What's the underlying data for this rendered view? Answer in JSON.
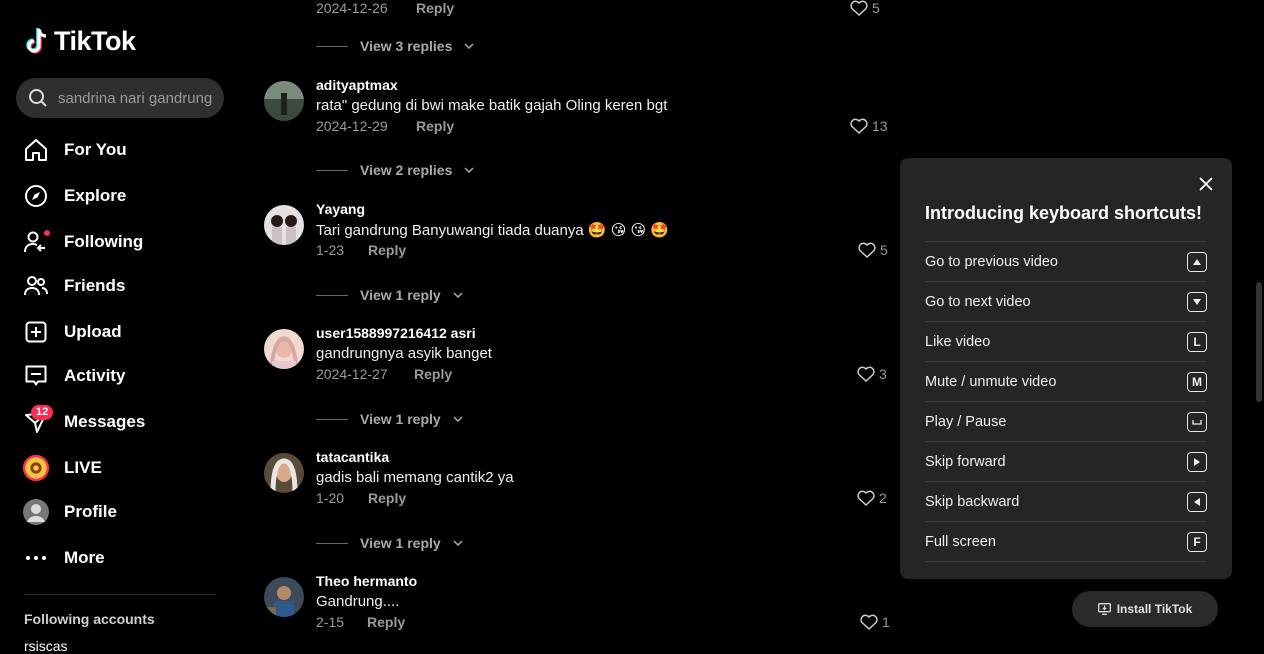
{
  "app": {
    "logo_text": "TikTok"
  },
  "search": {
    "placeholder": "sandrina nari gandrung"
  },
  "nav": {
    "for_you": "For You",
    "explore": "Explore",
    "following": "Following",
    "friends": "Friends",
    "upload": "Upload",
    "activity": "Activity",
    "messages": "Messages",
    "messages_badge": "12",
    "live": "LIVE",
    "profile": "Profile",
    "more": "More"
  },
  "sidebar": {
    "following_accounts_label": "Following accounts",
    "partial_account": "rsiscas"
  },
  "comments": {
    "top": {
      "date": "2024-12-26",
      "reply": "Reply",
      "likes": "5",
      "view_replies": "View 3 replies"
    },
    "items": [
      {
        "user": "adityaptmax",
        "text": "rata\" gedung di bwi make batik gajah Oling keren bgt",
        "date": "2024-12-29",
        "reply": "Reply",
        "likes": "13",
        "view_replies": "View 2 replies"
      },
      {
        "user": "Yayang",
        "text": "Tari gandrung Banyuwangi tiada duanya 🤩 😘 😘 🤩",
        "date": "1-23",
        "reply": "Reply",
        "likes": "5",
        "view_replies": "View 1 reply"
      },
      {
        "user": "user1588997216412 asri",
        "text": "gandrungnya asyik banget",
        "date": "2024-12-27",
        "reply": "Reply",
        "likes": "3",
        "view_replies": "View 1 reply"
      },
      {
        "user": "tatacantika",
        "text": "gadis bali memang cantik2 ya",
        "date": "1-20",
        "reply": "Reply",
        "likes": "2",
        "view_replies": "View 1 reply"
      },
      {
        "user": "Theo hermanto",
        "text": "Gandrung....",
        "date": "2-15",
        "reply": "Reply",
        "likes": "1"
      }
    ]
  },
  "shortcuts": {
    "title": "Introducing keyboard shortcuts!",
    "items": [
      {
        "label": "Go to previous video",
        "key": "up-arrow-key"
      },
      {
        "label": "Go to next video",
        "key": "down-arrow-key"
      },
      {
        "label": "Like video",
        "key_text": "L"
      },
      {
        "label": "Mute / unmute video",
        "key_text": "M"
      },
      {
        "label": "Play / Pause",
        "key": "space-key"
      },
      {
        "label": "Skip forward",
        "key": "right-arrow-key"
      },
      {
        "label": "Skip backward",
        "key": "left-arrow-key"
      },
      {
        "label": "Full screen",
        "key_text": "F"
      }
    ]
  },
  "install": {
    "label": "Install TikTok"
  },
  "colors": {
    "accent": "#fe2c55",
    "background": "#000000",
    "panel": "#252525"
  }
}
